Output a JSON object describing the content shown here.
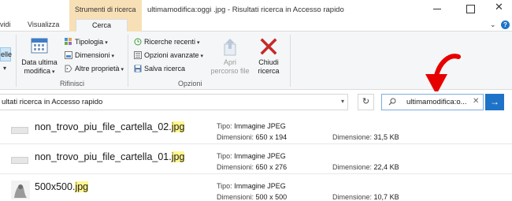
{
  "window": {
    "context_tab": "Strumenti di ricerca",
    "title": "ultimamodifica:oggi .jpg - Risultati ricerca in Accesso rapido"
  },
  "tabs": {
    "vidi": "vidi",
    "visualizza": "Visualizza",
    "cerca": "Cerca"
  },
  "ribbon": {
    "partial_button": "elle",
    "data_ultima_modifica_line1": "Data ultima",
    "data_ultima_modifica_line2": "modifica",
    "tipologia": "Tipologia",
    "dimensioni": "Dimensioni",
    "altre_proprieta": "Altre proprietà",
    "rifinisci_label": "Rifinisci",
    "ricerche_recenti": "Ricerche recenti",
    "opzioni_avanzate": "Opzioni avanzate",
    "salva_ricerca": "Salva ricerca",
    "apri_percorso_line1": "Apri",
    "apri_percorso_line2": "percorso file",
    "chiudi_ricerca_line1": "Chiudi",
    "chiudi_ricerca_line2": "ricerca",
    "opzioni_label": "Opzioni"
  },
  "address": {
    "path": "ultati ricerca in Accesso rapido",
    "search_value": "ultimamodifica:o..."
  },
  "results": [
    {
      "name_base": "non_trovo_piu_file_cartella_02.",
      "name_ext": "jpg",
      "tipo_label": "Tipo:",
      "tipo_value": "Immagine JPEG",
      "dim_label": "Dimensioni:",
      "dim_value": "650 x 194",
      "size_label": "Dimensione:",
      "size_value": "31,5 KB"
    },
    {
      "name_base": "non_trovo_piu_file_cartella_01.",
      "name_ext": "jpg",
      "tipo_label": "Tipo:",
      "tipo_value": "Immagine JPEG",
      "dim_label": "Dimensioni:",
      "dim_value": "650 x 276",
      "size_label": "Dimensione:",
      "size_value": "22,4 KB"
    },
    {
      "name_base": "500x500.",
      "name_ext": "jpg",
      "tipo_label": "Tipo:",
      "tipo_value": "Immagine JPEG",
      "dim_label": "Dimensioni:",
      "dim_value": "500 x 500",
      "size_label": "Dimensione:",
      "size_value": "10,7 KB"
    }
  ],
  "colors": {
    "context_tab": "#f8e0b6",
    "accent": "#1e73c8",
    "highlight": "#fff68f",
    "arrow": "#e60000"
  }
}
